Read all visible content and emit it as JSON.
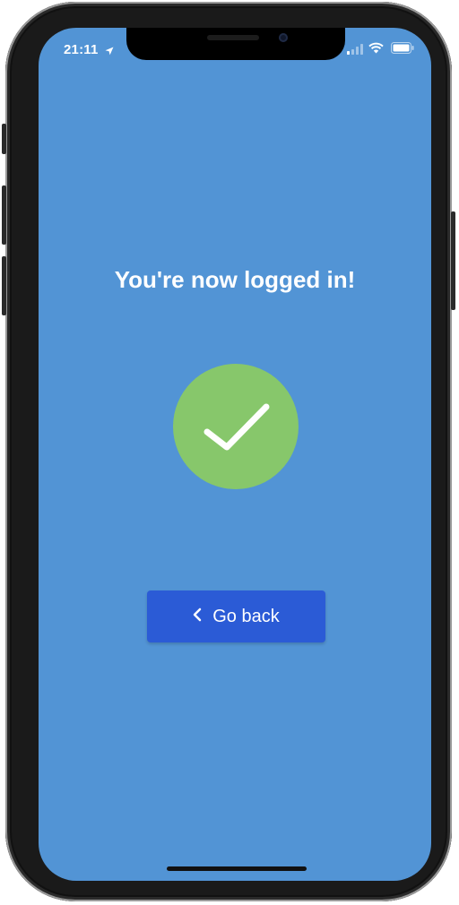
{
  "status_bar": {
    "time": "21:11",
    "location_icon": "location-arrow-icon",
    "signal_icon": "cellular-signal-icon",
    "wifi_icon": "wifi-icon",
    "battery_icon": "battery-icon"
  },
  "main": {
    "title": "You're now logged in!",
    "success_icon": "checkmark-icon",
    "success_color": "#87c76b"
  },
  "actions": {
    "go_back_label": "Go back",
    "go_back_icon": "chevron-left-icon"
  },
  "theme": {
    "background": "#5294d5",
    "button": "#2b5bd6"
  }
}
